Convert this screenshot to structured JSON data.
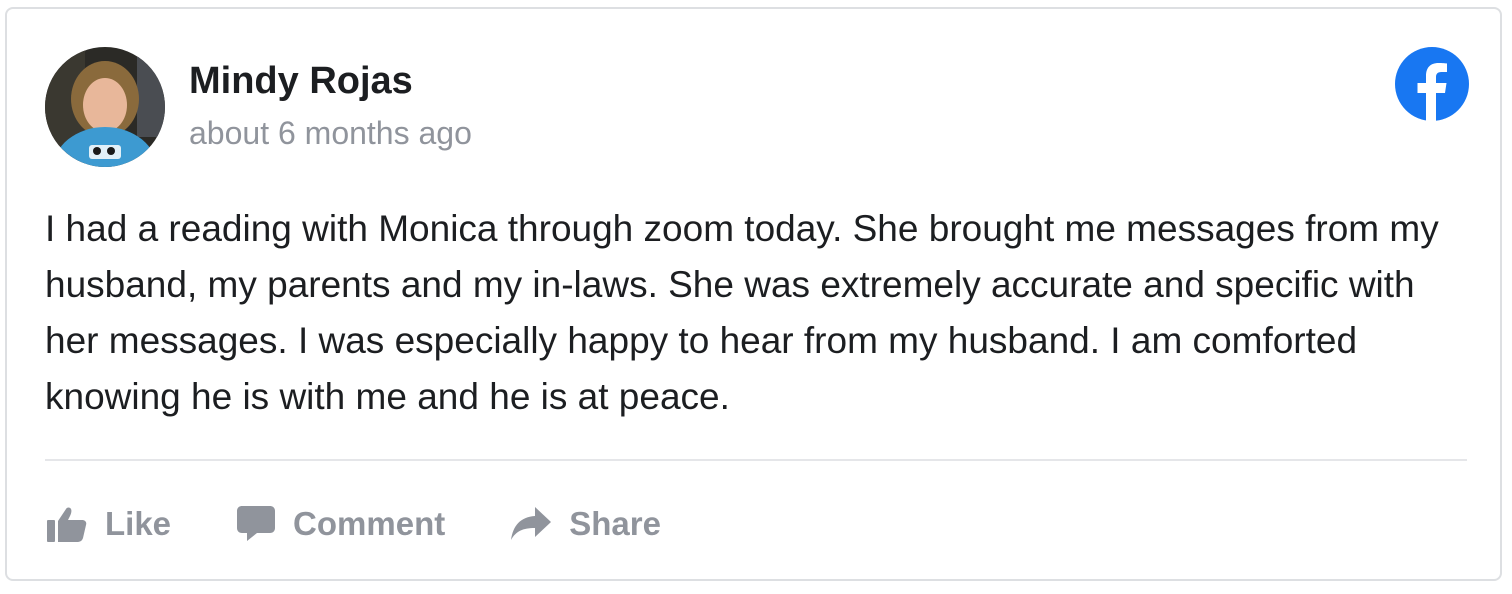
{
  "post": {
    "author": "Mindy Rojas",
    "timestamp": "about 6 months ago",
    "text": "I had a reading with Monica through zoom today. She brought me messages from my husband, my parents and my in-laws. She was extremely accurate and specific with her messages. I was especially happy to hear from my husband. I am comforted knowing he is with me and he is at peace."
  },
  "actions": {
    "like_label": "Like",
    "comment_label": "Comment",
    "share_label": "Share"
  },
  "icons": {
    "brand": "facebook-icon",
    "like": "thumbs-up-icon",
    "comment": "speech-bubble-icon",
    "share": "share-arrow-icon"
  },
  "colors": {
    "facebook_blue": "#1877f2",
    "action_gray": "#90949c",
    "text": "#1c1e21",
    "divider": "#e5e6e9"
  }
}
